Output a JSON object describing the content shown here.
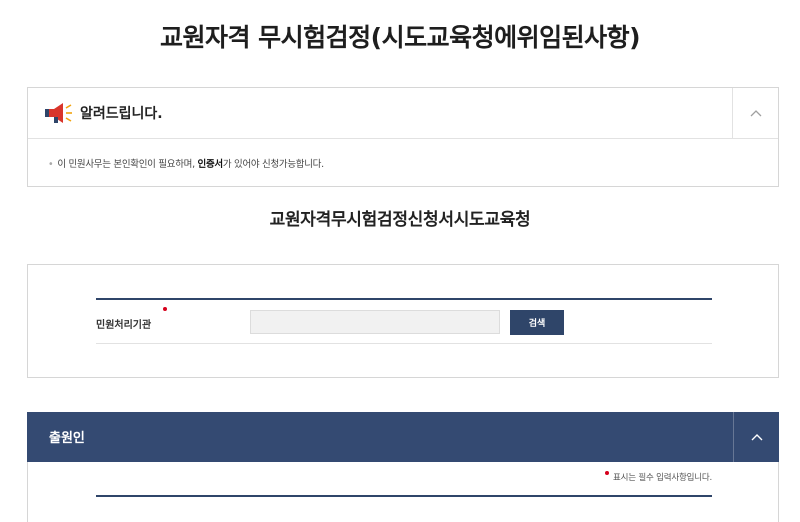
{
  "page": {
    "title": "교원자격 무시험검정(시도교육청에위임된사항)"
  },
  "notice": {
    "title": "알려드립니다.",
    "icon": "megaphone-icon",
    "collapse_icon": "chevron-up-icon",
    "text_before": "이 민원사무는 본인확인이 필요하며, ",
    "text_bold": "인증서",
    "text_after": "가 있어야 신청가능합니다."
  },
  "form": {
    "title": "교원자격무시험검정신청서시도교육청"
  },
  "org_section": {
    "label": "민원처리기관",
    "input_value": "",
    "search_button": "검색"
  },
  "applicant": {
    "title": "출원인",
    "collapse_icon": "chevron-up-icon",
    "required_note": "표시는 필수 입력사항입니다."
  },
  "colors": {
    "navy": "#2f4569",
    "header_navy": "#344a72",
    "required": "#d6001c"
  }
}
